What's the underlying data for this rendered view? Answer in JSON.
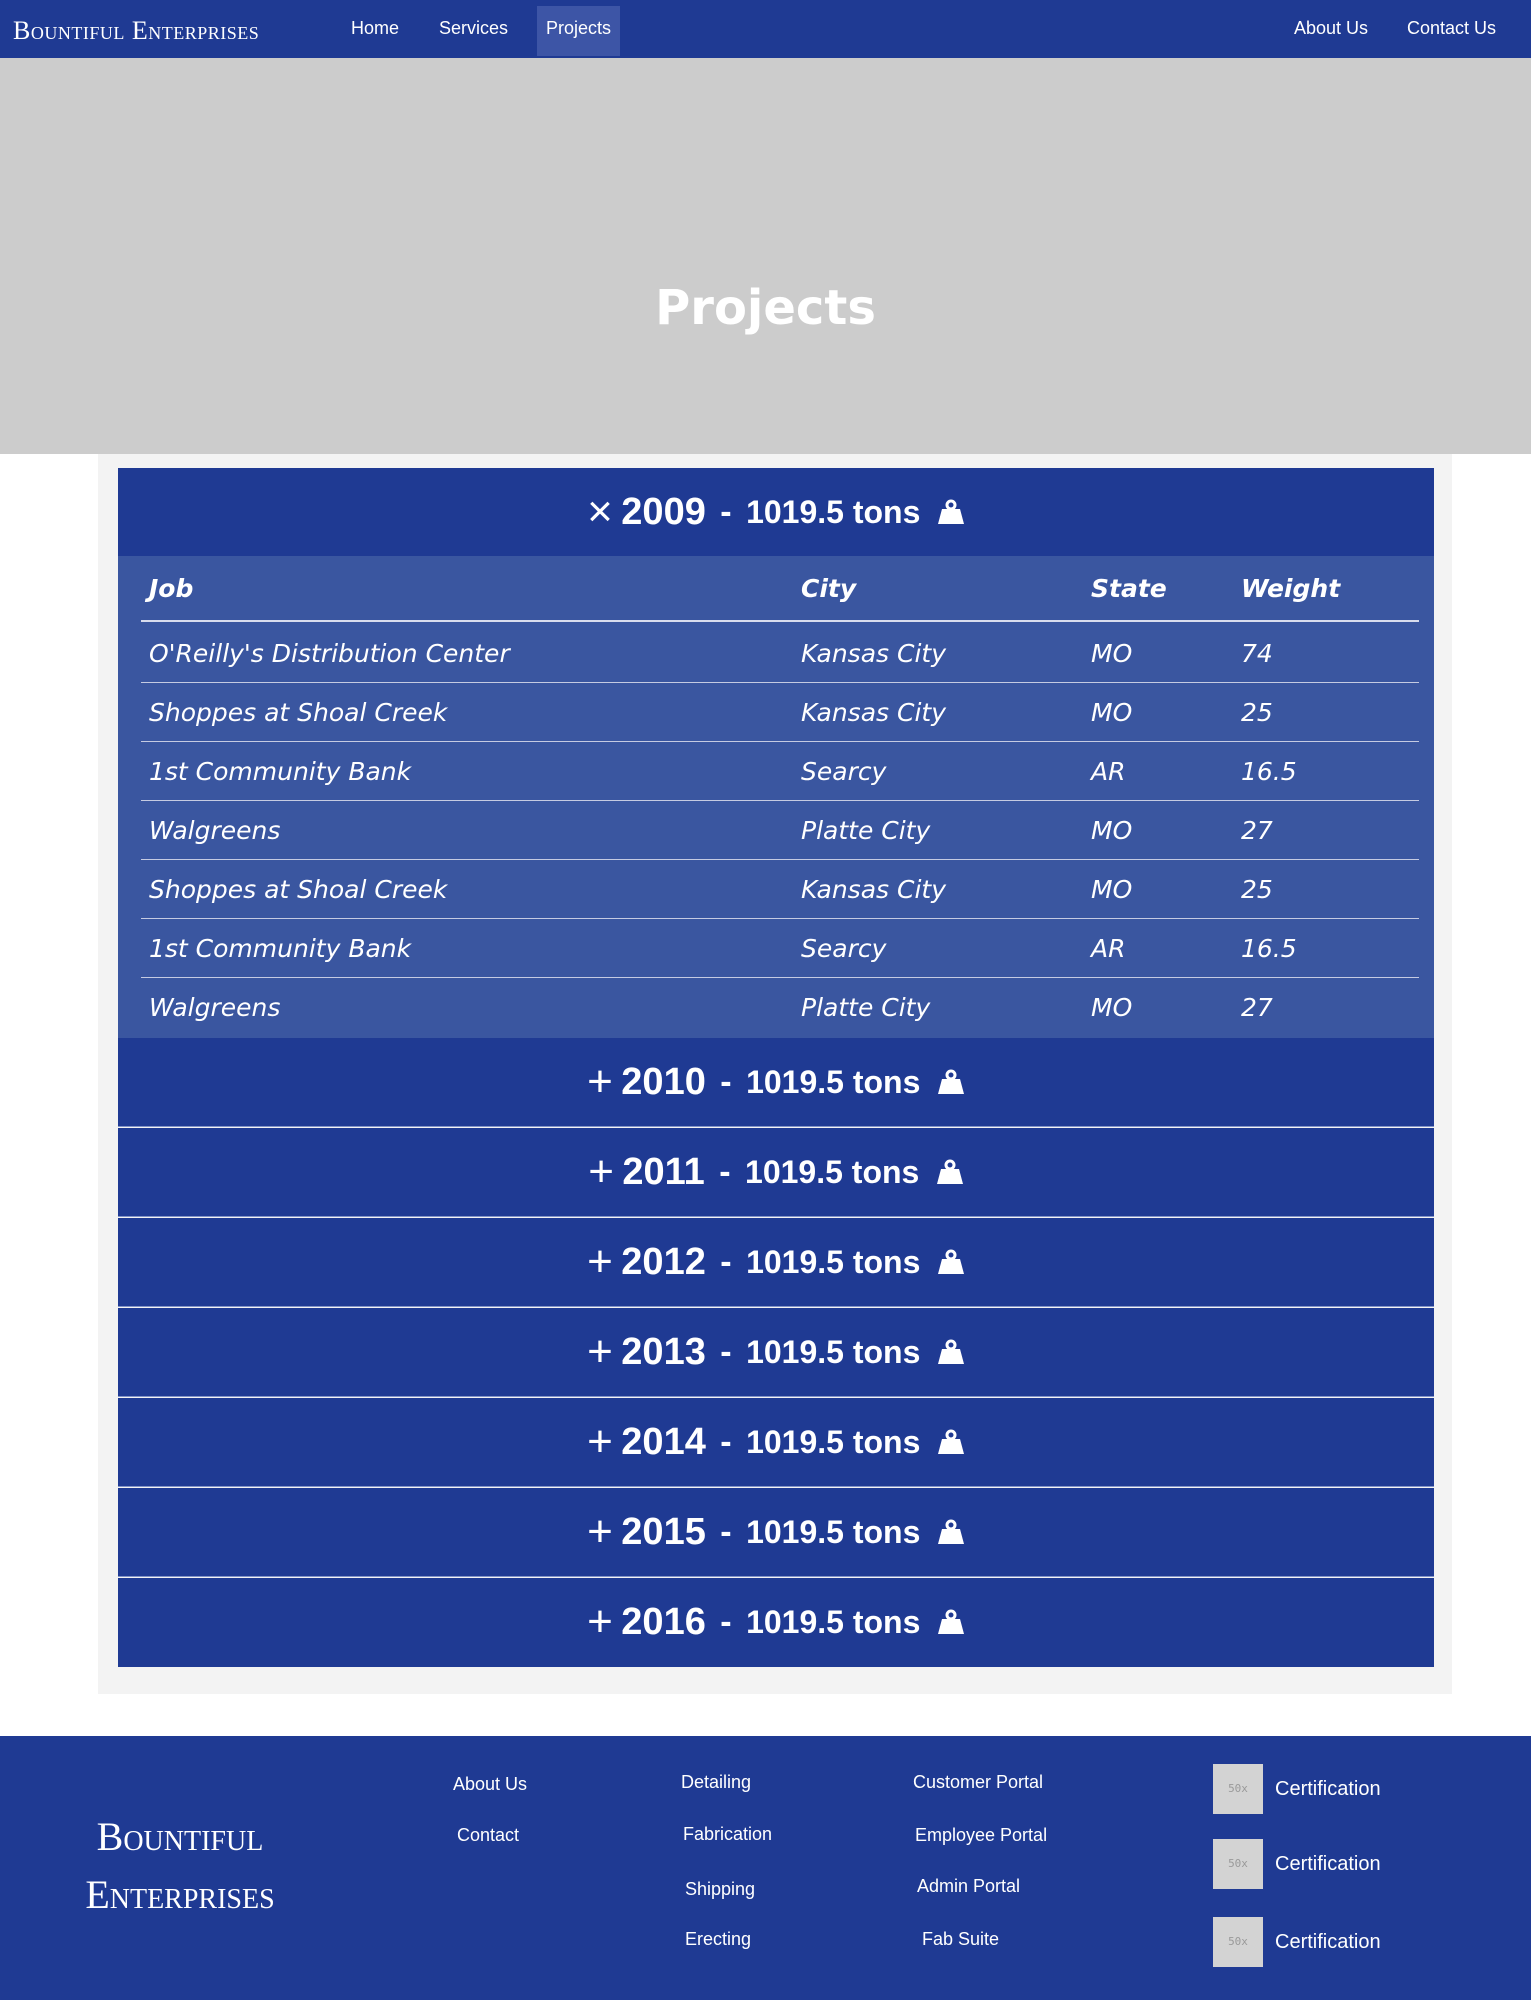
{
  "nav": {
    "brand": "Bountiful Enterprises",
    "left_items": [
      {
        "label": "Home"
      },
      {
        "label": "Services"
      },
      {
        "label": "Projects",
        "active": true
      }
    ],
    "right_items": [
      {
        "label": "About Us"
      },
      {
        "label": "Contact Us"
      }
    ]
  },
  "hero": {
    "title": "Projects"
  },
  "accordion": {
    "weight_icon": "weight-icon",
    "dash": "-",
    "years": [
      {
        "year": "2009",
        "tons": "1019.5 tons",
        "expanded": true,
        "toggle_icon": "close-icon",
        "toggle_glyph": "×"
      },
      {
        "year": "2010",
        "tons": "1019.5 tons",
        "expanded": false,
        "toggle_icon": "plus-icon",
        "toggle_glyph": "+"
      },
      {
        "year": "2011",
        "tons": "1019.5 tons",
        "expanded": false,
        "toggle_icon": "plus-icon",
        "toggle_glyph": "+"
      },
      {
        "year": "2012",
        "tons": "1019.5 tons",
        "expanded": false,
        "toggle_icon": "plus-icon",
        "toggle_glyph": "+"
      },
      {
        "year": "2013",
        "tons": "1019.5 tons",
        "expanded": false,
        "toggle_icon": "plus-icon",
        "toggle_glyph": "+"
      },
      {
        "year": "2014",
        "tons": "1019.5 tons",
        "expanded": false,
        "toggle_icon": "plus-icon",
        "toggle_glyph": "+"
      },
      {
        "year": "2015",
        "tons": "1019.5 tons",
        "expanded": false,
        "toggle_icon": "plus-icon",
        "toggle_glyph": "+"
      },
      {
        "year": "2016",
        "tons": "1019.5 tons",
        "expanded": false,
        "toggle_icon": "plus-icon",
        "toggle_glyph": "+"
      }
    ]
  },
  "projects_table": {
    "columns": [
      "Job",
      "City",
      "State",
      "Weight"
    ],
    "rows": [
      [
        "O'Reilly's Distribution Center",
        "Kansas City",
        "MO",
        "74"
      ],
      [
        "Shoppes at Shoal Creek",
        "Kansas City",
        "MO",
        "25"
      ],
      [
        "1st Community Bank",
        "Searcy",
        "AR",
        "16.5"
      ],
      [
        "Walgreens",
        "Platte City",
        "MO",
        "27"
      ],
      [
        "Shoppes at Shoal Creek",
        "Kansas City",
        "MO",
        "25"
      ],
      [
        "1st Community Bank",
        "Searcy",
        "AR",
        "16.5"
      ],
      [
        "Walgreens",
        "Platte City",
        "MO",
        "27"
      ]
    ]
  },
  "footer": {
    "brand_line1": "Bountiful",
    "brand_line2": "Enterprises",
    "col1": [
      "About Us",
      "Contact"
    ],
    "col2": [
      "Detailing",
      "Fabrication",
      "Shipping",
      "Erecting"
    ],
    "col3": [
      "Customer Portal",
      "Employee Portal",
      "Admin Portal",
      "Fab Suite"
    ],
    "certifications": [
      {
        "placeholder": "50x",
        "label": "Certification"
      },
      {
        "placeholder": "50x",
        "label": "Certification"
      },
      {
        "placeholder": "50x",
        "label": "Certification"
      }
    ]
  },
  "colors": {
    "primary": "#1f3a93",
    "table_bg": "#3a56a0",
    "hero_bg": "#cccccc",
    "panel_bg": "#f3f3f3"
  }
}
